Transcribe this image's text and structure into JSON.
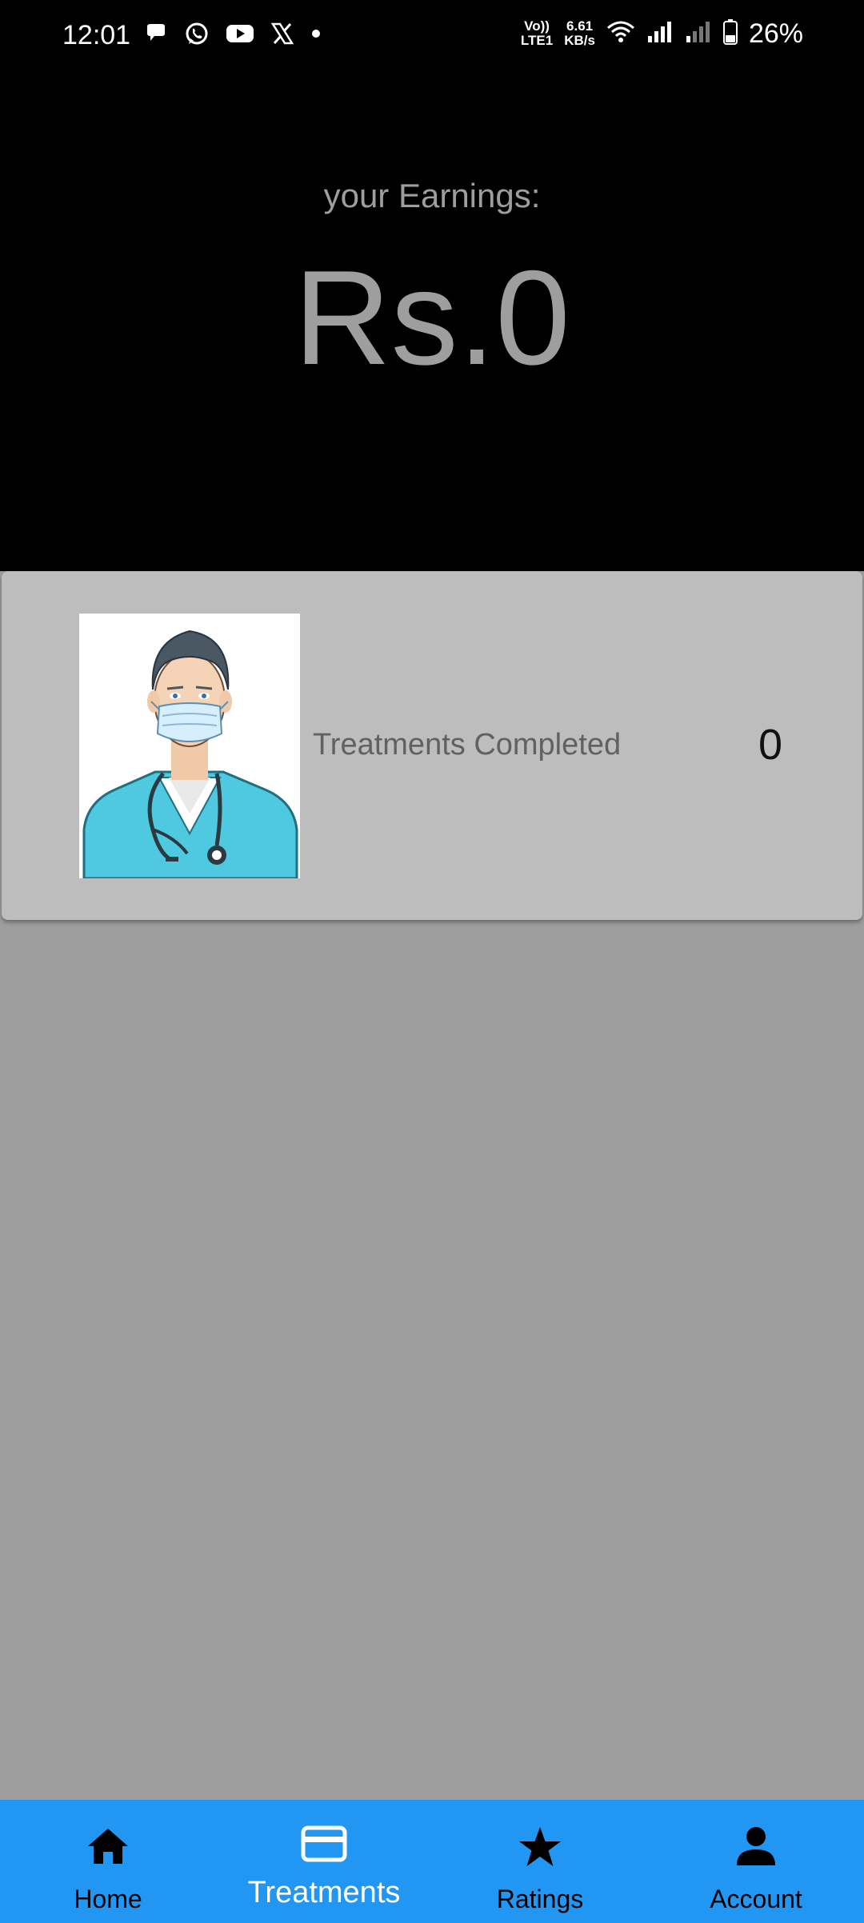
{
  "status_bar": {
    "time": "12:01",
    "volte_top": "Vo))",
    "volte_bottom": "LTE1",
    "net_speed_value": "6.61",
    "net_speed_unit": "KB/s",
    "battery": "26%",
    "left_icons": [
      "chat-icon",
      "whatsapp-icon",
      "youtube-icon",
      "x-icon",
      "dot-icon"
    ],
    "right_icons": [
      "wifi-icon",
      "signal-icon",
      "signal-weak-icon",
      "battery-icon"
    ]
  },
  "earnings": {
    "label": "your Earnings:",
    "amount": "Rs.0"
  },
  "stats_card": {
    "label": "Treatments Completed",
    "value": "0",
    "image": "doctor-illustration"
  },
  "bottom_nav": {
    "active": "Treatments",
    "items": [
      {
        "label": "Home",
        "icon": "home-icon"
      },
      {
        "label": "Treatments",
        "icon": "card-icon"
      },
      {
        "label": "Ratings",
        "icon": "star-icon"
      },
      {
        "label": "Account",
        "icon": "person-icon"
      }
    ]
  },
  "colors": {
    "nav_bg": "#2196f3",
    "header_bg": "#000000",
    "card_bg": "#bdbdbd",
    "page_bg": "#9e9e9e",
    "earnings_text": "#9e9e9e"
  }
}
